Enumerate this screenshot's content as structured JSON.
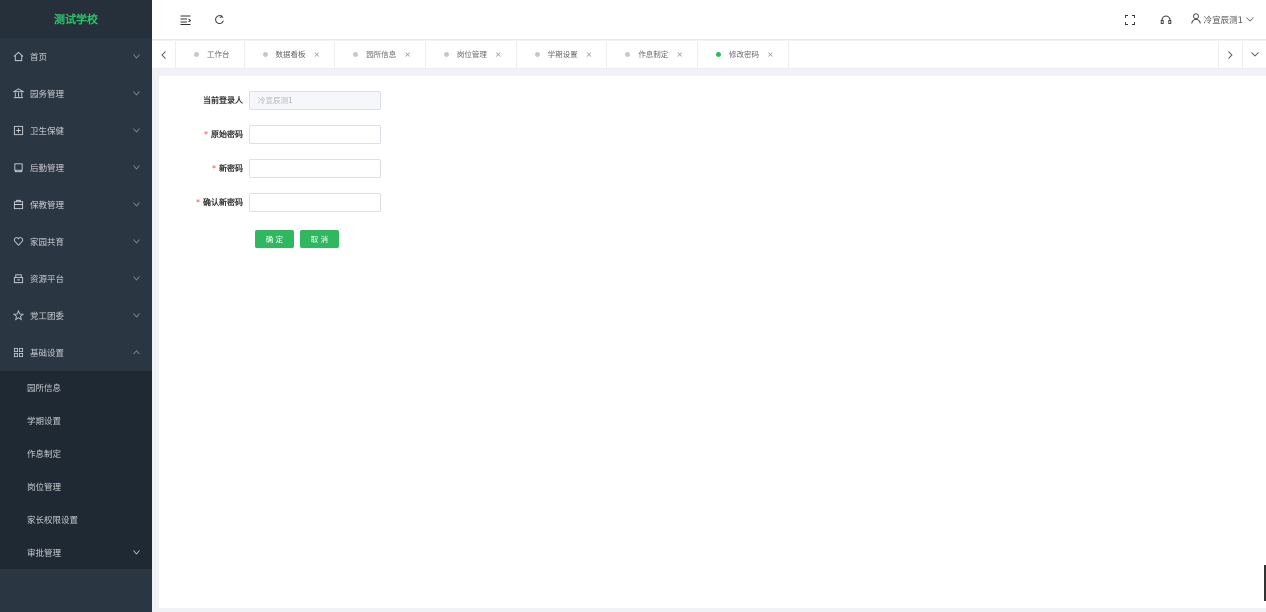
{
  "app": {
    "title": "测试学校"
  },
  "sidebar": {
    "items": [
      {
        "label": "首页",
        "icon": "home-icon"
      },
      {
        "label": "园务管理",
        "icon": "bank-icon"
      },
      {
        "label": "卫生保健",
        "icon": "medical-icon"
      },
      {
        "label": "后勤管理",
        "icon": "logistics-icon"
      },
      {
        "label": "保教管理",
        "icon": "education-icon"
      },
      {
        "label": "家园共育",
        "icon": "heart-icon"
      },
      {
        "label": "资源平台",
        "icon": "resource-icon"
      },
      {
        "label": "党工团委",
        "icon": "star-icon"
      },
      {
        "label": "基础设置",
        "icon": "grid-icon"
      }
    ],
    "submenu": [
      {
        "label": "园所信息"
      },
      {
        "label": "学期设置"
      },
      {
        "label": "作息制定"
      },
      {
        "label": "岗位管理"
      },
      {
        "label": "家长权限设置"
      },
      {
        "label": "审批管理"
      }
    ]
  },
  "header": {
    "user": {
      "name": "冷宣辰测1"
    }
  },
  "tabs": [
    {
      "label": "工作台",
      "closable": false
    },
    {
      "label": "数据看板",
      "closable": true
    },
    {
      "label": "园所信息",
      "closable": true
    },
    {
      "label": "岗位管理",
      "closable": true
    },
    {
      "label": "学期设置",
      "closable": true
    },
    {
      "label": "作息制定",
      "closable": true
    },
    {
      "label": "修改密码",
      "closable": true,
      "active": true
    }
  ],
  "form": {
    "current_user_label": "当前登录人",
    "current_user_value": "冷宣辰测1",
    "old_password_label": "原始密码",
    "new_password_label": "新密码",
    "confirm_password_label": "确认新密码",
    "required_mark": "*",
    "confirm_button": "确 定",
    "cancel_button": "取 消"
  },
  "colors": {
    "sidebar_bg": "#2b3643",
    "accent": "#2fb85f",
    "logo": "#2fc06a",
    "required": "#e74c3c"
  }
}
